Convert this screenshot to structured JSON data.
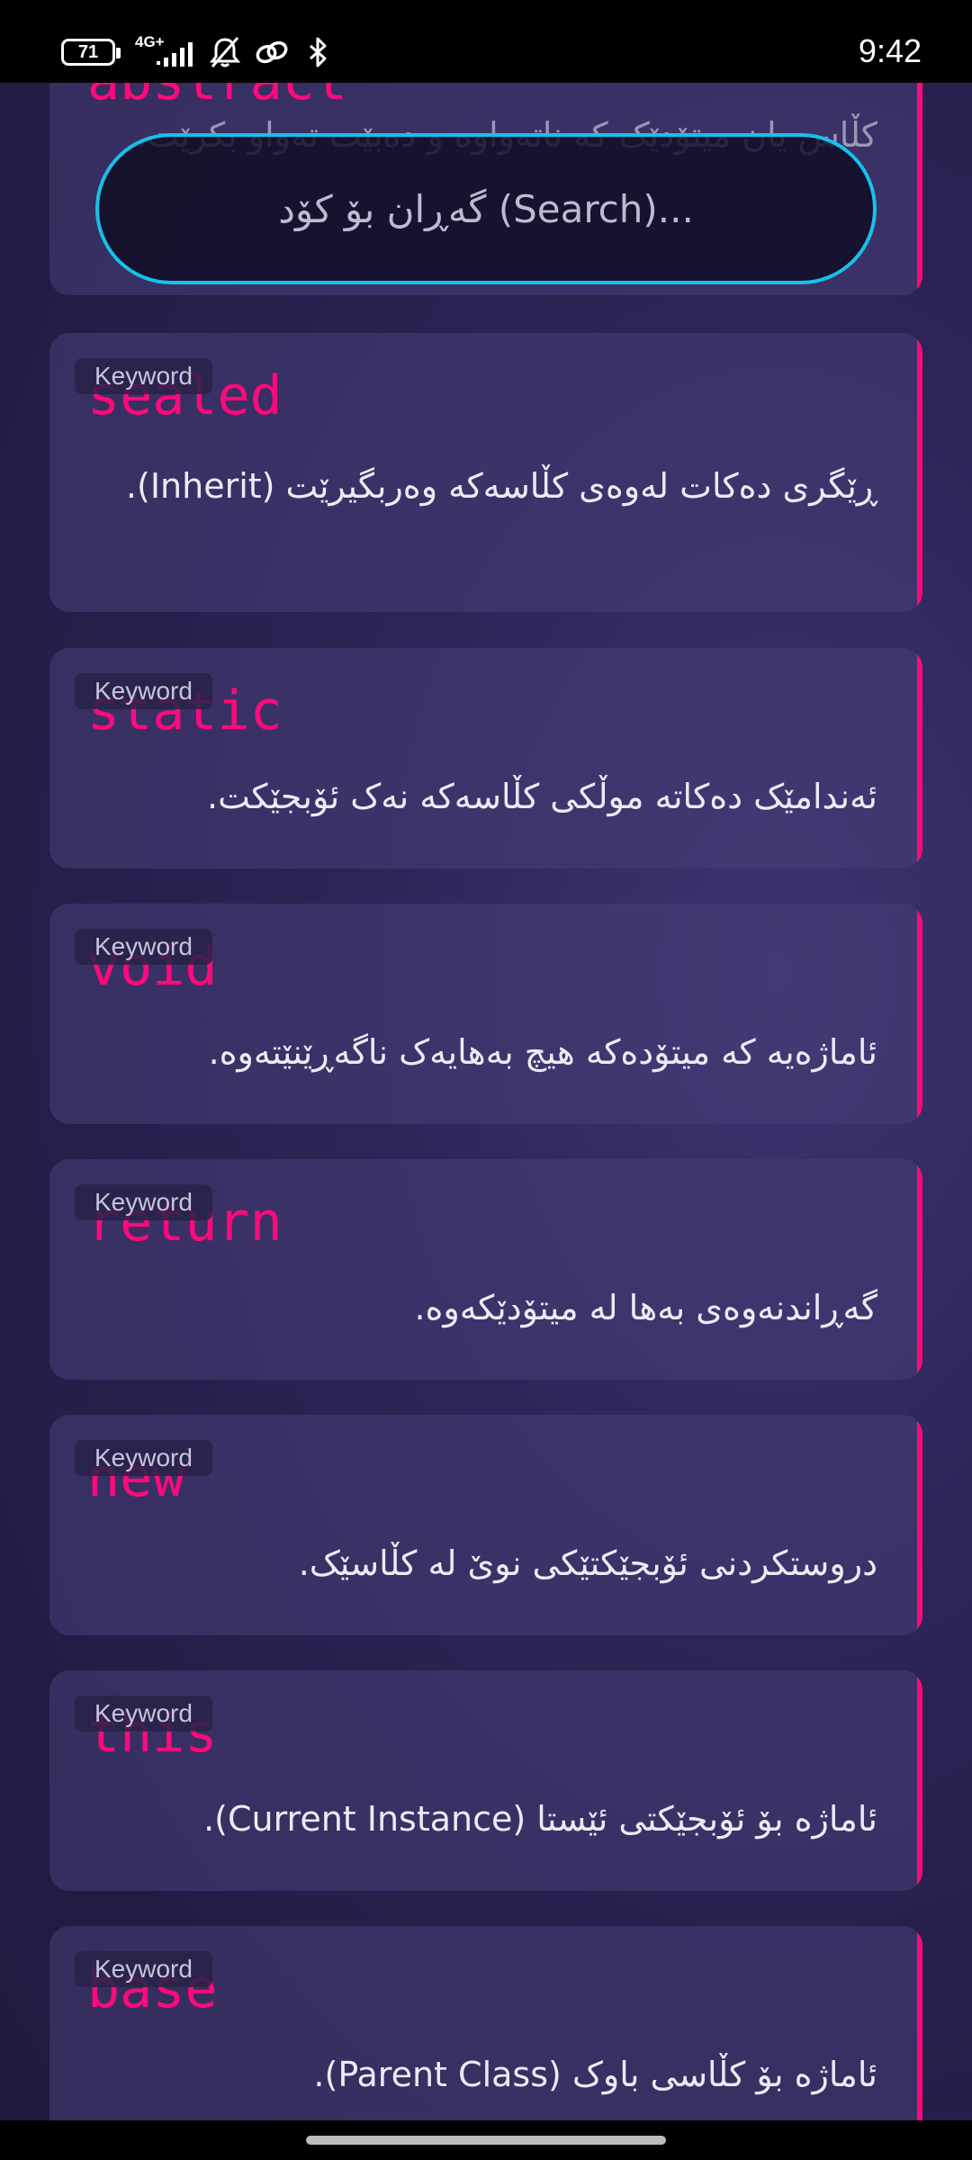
{
  "status_bar": {
    "battery": "71",
    "network": "4G+",
    "time": "9:42"
  },
  "search": {
    "placeholder": "گەڕان بۆ کۆد (Search)..."
  },
  "badge_label": "Keyword",
  "cards": [
    {
      "keyword": "abstract",
      "description": "کڵاس یان میتۆدێک کە ناتەواوە و دەبێت تەواو بکرێت."
    },
    {
      "keyword": "sealed",
      "description": "ڕێگری دەکات لەوەی کڵاسەکە وەربگیرێت (Inherit)."
    },
    {
      "keyword": "static",
      "description": "ئەندامێک دەکاتە موڵکی کڵاسەکە نەک ئۆبجێکت."
    },
    {
      "keyword": "void",
      "description": "ئاماژەیە کە میتۆدەکە هیچ بەهایەک ناگەڕێنێتەوە."
    },
    {
      "keyword": "return",
      "description": "گەڕاندنەوەی بەها لە میتۆدێکەوە."
    },
    {
      "keyword": "new",
      "description": "دروستکردنی ئۆبجێکتێکی نوێ لە کڵاسێک."
    },
    {
      "keyword": "this",
      "description": "ئاماژە بۆ ئۆبجێکتی ئێستا (Current Instance)."
    },
    {
      "keyword": "base",
      "description": "ئاماژە بۆ کڵاسی باوک (Parent Class)."
    }
  ]
}
